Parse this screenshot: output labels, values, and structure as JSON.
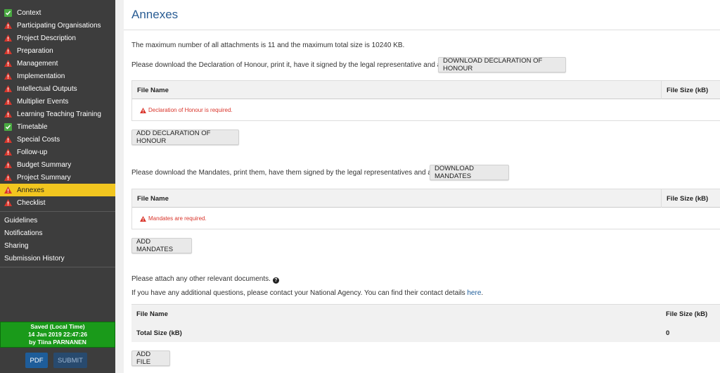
{
  "sidebar": {
    "items": [
      {
        "label": "Context",
        "status": "ok",
        "active": false
      },
      {
        "label": "Participating Organisations",
        "status": "warn",
        "active": false
      },
      {
        "label": "Project Description",
        "status": "warn",
        "active": false
      },
      {
        "label": "Preparation",
        "status": "warn",
        "active": false
      },
      {
        "label": "Management",
        "status": "warn",
        "active": false
      },
      {
        "label": "Implementation",
        "status": "warn",
        "active": false
      },
      {
        "label": "Intellectual Outputs",
        "status": "warn",
        "active": false
      },
      {
        "label": "Multiplier Events",
        "status": "warn",
        "active": false
      },
      {
        "label": "Learning Teaching Training",
        "status": "warn",
        "active": false
      },
      {
        "label": "Timetable",
        "status": "ok",
        "active": false
      },
      {
        "label": "Special Costs",
        "status": "warn",
        "active": false
      },
      {
        "label": "Follow-up",
        "status": "warn",
        "active": false
      },
      {
        "label": "Budget Summary",
        "status": "warn",
        "active": false
      },
      {
        "label": "Project Summary",
        "status": "warn",
        "active": false
      },
      {
        "label": "Annexes",
        "status": "warn",
        "active": true
      },
      {
        "label": "Checklist",
        "status": "warn",
        "active": false
      }
    ],
    "links": [
      "Guidelines",
      "Notifications",
      "Sharing",
      "Submission History"
    ],
    "saved": {
      "line1": "Saved (Local Time)",
      "line2": "14 Jan 2019 22:47:26",
      "line3": "by Tiina PARNANEN"
    },
    "pdf_label": "PDF",
    "submit_label": "SUBMIT"
  },
  "colors": {
    "accent": "#2a5d94",
    "active": "#f2c61f",
    "warning": "#d9352b",
    "ok": "#49a941",
    "saved": "#1a9a1a"
  },
  "main": {
    "title": "Annexes",
    "limits": "The maximum number of all attachments is 11 and the maximum total size is 10240 KB.",
    "declaration": {
      "instruction": "Please download the Declaration of Honour, print it, have it signed by the legal representative and attach.",
      "download_label": "DOWNLOAD DECLARATION OF HONOUR",
      "col_name": "File Name",
      "col_size": "File Size (kB)",
      "error": "Declaration of Honour is required.",
      "add_label": "ADD DECLARATION OF HONOUR"
    },
    "mandates": {
      "instruction": "Please download the Mandates, print them, have them signed by the legal representatives and attach.",
      "download_label": "DOWNLOAD MANDATES",
      "col_name": "File Name",
      "col_size": "File Size (kB)",
      "error": "Mandates are required.",
      "add_label": "ADD MANDATES"
    },
    "other": {
      "instruction": "Please attach any other relevant documents.",
      "contact_text": "If you have any additional questions, please contact your National Agency. You can find their contact details",
      "contact_link": "here",
      "col_name": "File Name",
      "col_size": "File Size (kB)",
      "total_label": "Total Size (kB)",
      "total_value": "0",
      "add_label": "ADD FILE"
    }
  }
}
